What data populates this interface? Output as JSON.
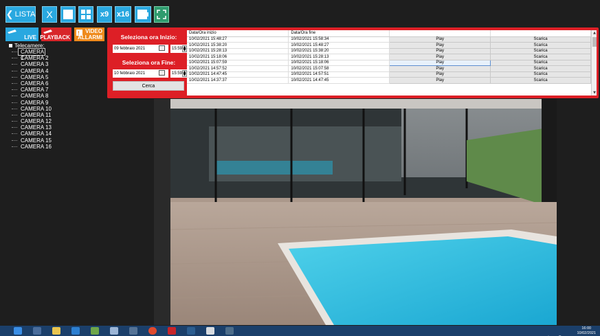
{
  "toolbar": {
    "lista_label": "LISTA",
    "close_label": "X",
    "x9_label": "x9",
    "x16_label": "x16"
  },
  "modes": {
    "live": "LIVE",
    "playback": "PLAYBACK",
    "video_top": "VIDEO",
    "video_bottom": "ALLARMI"
  },
  "tree": {
    "root": "Telecamere:",
    "cameras": [
      "CAMERA 1",
      "CAMERA 2",
      "CAMERA 3",
      "CAMERA 4",
      "CAMERA 5",
      "CAMERA 6",
      "CAMERA 7",
      "CAMERA 8",
      "CAMERA 9",
      "CAMERA 10",
      "CAMERA 11",
      "CAMERA 12",
      "CAMERA 13",
      "CAMERA 14",
      "CAMERA 15",
      "CAMERA 16"
    ],
    "selected": "CAMERA 1"
  },
  "search": {
    "start_label": "Seleziona ora Inizio:",
    "start_day": "09",
    "start_month": "febbraio",
    "start_year": "2021",
    "start_time": "15:59",
    "end_label": "Seleziona ora Fine:",
    "end_day": "10",
    "end_month": "febbraio",
    "end_year": "2021",
    "end_time": "15:59",
    "search_button": "Cerca"
  },
  "results": {
    "headers": [
      "Data/Ora inizio",
      "Data/Ora fine",
      "",
      ""
    ],
    "rows": [
      {
        "start": "10/02/2021 15:48:27",
        "end": "10/02/2021 15:58:34",
        "play": "Play",
        "download": "Scarica"
      },
      {
        "start": "10/02/2021 15:38:20",
        "end": "10/02/2021 15:48:27",
        "play": "Play",
        "download": "Scarica"
      },
      {
        "start": "10/02/2021 15:28:13",
        "end": "10/02/2021 15:38:20",
        "play": "Play",
        "download": "Scarica"
      },
      {
        "start": "10/02/2021 15:18:06",
        "end": "10/02/2021 15:28:13",
        "play": "Play",
        "download": "Scarica"
      },
      {
        "start": "10/02/2021 15:07:59",
        "end": "10/02/2021 15:18:06",
        "play": "Play",
        "download": "Scarica"
      },
      {
        "start": "10/02/2021 14:57:52",
        "end": "10/02/2021 15:07:58",
        "play": "Play",
        "download": "Scarica"
      },
      {
        "start": "10/02/2021 14:47:45",
        "end": "10/02/2021 14:57:51",
        "play": "Play",
        "download": "Scarica"
      },
      {
        "start": "10/02/2021 14:37:37",
        "end": "10/02/2021 14:47:45",
        "play": "Play",
        "download": "Scarica"
      }
    ],
    "highlighted_row": 4
  },
  "taskbar": {
    "time": "16:00",
    "date": "10/02/2021"
  },
  "colors": {
    "accent_blue": "#29a8e0",
    "panel_red": "#dd1f26",
    "taskbar": "#1b3f6a"
  }
}
